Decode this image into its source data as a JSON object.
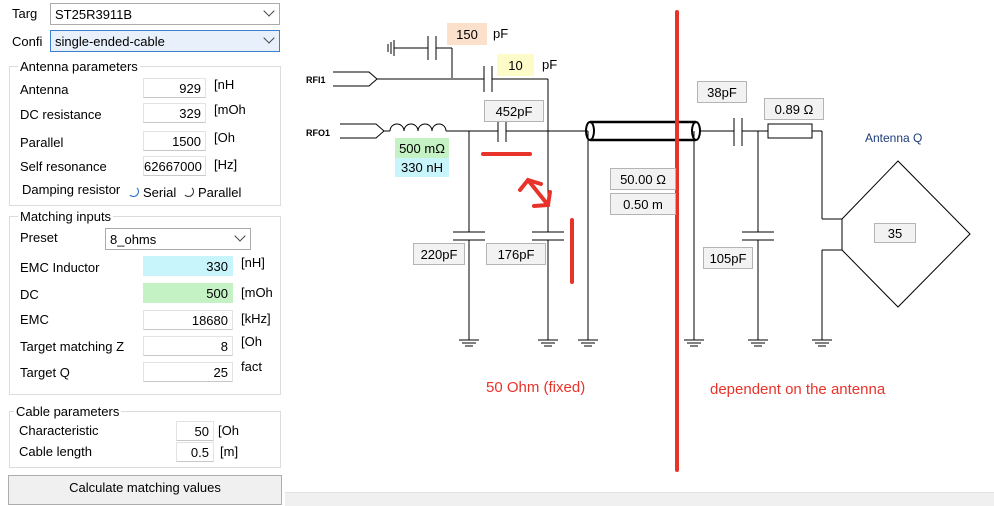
{
  "top": {
    "target_label": "Targ",
    "target_value": "ST25R3911B",
    "config_label": "Confi",
    "config_value": "single-ended-cable"
  },
  "antenna": {
    "title": "Antenna parameters",
    "rows": [
      {
        "label": "Antenna",
        "value": "929",
        "unit": "[nH"
      },
      {
        "label": "DC resistance",
        "value": "329",
        "unit": "[mOh"
      },
      {
        "label": "Parallel",
        "value": "1500",
        "unit": "[Oh"
      },
      {
        "label": "Self resonance",
        "value": "62667000",
        "unit": "[Hz]"
      }
    ],
    "damping_label": "Damping resistor",
    "damping_serial": "Serial",
    "damping_parallel": "Parallel"
  },
  "matching": {
    "title": "Matching inputs",
    "preset_label": "Preset",
    "preset_value": "8_ohms",
    "rows": [
      {
        "label": "EMC Inductor",
        "value": "330",
        "unit": "[nH]"
      },
      {
        "label": "DC",
        "value": "500",
        "unit": "[mOh"
      },
      {
        "label": "EMC",
        "value": "18680",
        "unit": "[kHz]"
      },
      {
        "label": "Target matching Z",
        "value": "8",
        "unit": "[Oh"
      },
      {
        "label": "Target Q",
        "value": "25",
        "unit": "fact"
      }
    ]
  },
  "cable": {
    "title": "Cable parameters",
    "rows": [
      {
        "label": "Characteristic",
        "value": "50",
        "unit": "[Oh"
      },
      {
        "label": "Cable length",
        "value": "0.5",
        "unit": "[m]"
      }
    ]
  },
  "calc_button": "Calculate matching values",
  "schematic": {
    "rfi1": "RFI1",
    "rfo1": "RFO1",
    "cap_150": "150",
    "cap_150_unit": "pF",
    "cap_10": "10",
    "cap_10_unit": "pF",
    "c452": "452pF",
    "r500": "500 mΩ",
    "l330": "330 nH",
    "c220": "220pF",
    "c176": "176pF",
    "z_cable": "50.00 Ω",
    "len_cable": "0.50 m",
    "c38": "38pF",
    "r089": "0.89 Ω",
    "c105": "105pF",
    "antenna_q_label": "Antenna Q",
    "antenna_q_value": "35"
  },
  "annotations": {
    "left_note": "50 Ohm (fixed)",
    "right_note": "dependent on the antenna"
  },
  "colors": {
    "emc_inductor_bg": "#c8f5fb",
    "dc_bg": "#c4f2c4",
    "cap150_bg": "#fbe0cc",
    "cap10_bg": "#fdfcc8",
    "r500_bg": "#c4f2c4",
    "l330_bg": "#c8f5fb",
    "annotation_red": "#e8332a"
  }
}
